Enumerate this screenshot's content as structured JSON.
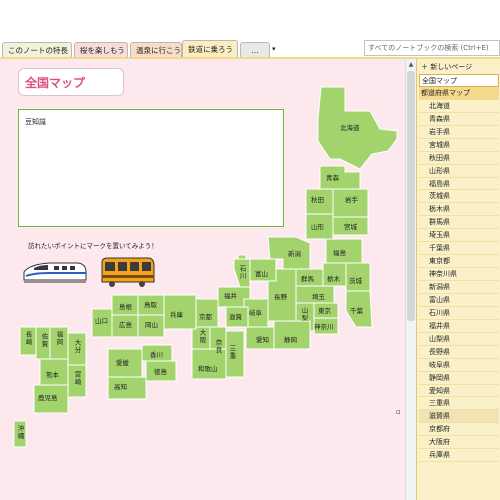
{
  "tabs": [
    {
      "label": "このノートの特長"
    },
    {
      "label": "桜を楽しもう"
    },
    {
      "label": "温泉に行こう"
    },
    {
      "label": "鉄道に乗ろう"
    }
  ],
  "tab_overflow": "...",
  "tab_add": "▾",
  "search": {
    "placeholder": "すべてのノートブックの検索 (Ctrl+E)"
  },
  "page": {
    "title": "全国マップ",
    "trivia_label": "豆知識",
    "hint": "訪れたいポイントにマークを置いてみよう！"
  },
  "map_labels": {
    "hokkaido": "北海道",
    "aomori": "青森",
    "akita": "秋田",
    "iwate": "岩手",
    "yamagata": "山形",
    "miyagi": "宮城",
    "fukushima": "福島",
    "niigata": "新潟",
    "ibaraki": "茨城",
    "tochigi": "栃木",
    "gunma": "群馬",
    "saitama": "埼玉",
    "chiba": "千葉",
    "tokyo": "東京",
    "kanagawa": "神奈川",
    "yamanashi": "山梨",
    "nagano": "長野",
    "toyama": "富山",
    "ishikawa": "石川",
    "fukui": "福井",
    "gifu": "岐阜",
    "shizuoka": "静岡",
    "aichi": "愛知",
    "mie": "三重",
    "shiga": "滋賀",
    "kyoto": "京都",
    "osaka": "大阪",
    "hyogo": "兵庫",
    "nara": "奈良",
    "wakayama": "和歌山",
    "tottori": "鳥取",
    "shimane": "島根",
    "okayama": "岡山",
    "hiroshima": "広島",
    "yamaguchi": "山口",
    "tokushima": "徳島",
    "kagawa": "香川",
    "ehime": "愛媛",
    "kochi": "高知",
    "fukuoka": "福岡",
    "saga": "佐賀",
    "nagasaki": "長崎",
    "kumamoto": "熊本",
    "oita": "大分",
    "miyazaki": "宮崎",
    "kagoshima": "鹿児島",
    "okinawa": "沖縄"
  },
  "pane": {
    "new_page": "新しいページ",
    "pages": [
      {
        "label": "全国マップ",
        "level": 0,
        "state": "selected"
      },
      {
        "label": "都道府県マップ",
        "level": 0,
        "state": "parent"
      },
      {
        "label": "北海道",
        "level": 1
      },
      {
        "label": "青森県",
        "level": 1
      },
      {
        "label": "岩手県",
        "level": 1
      },
      {
        "label": "宮城県",
        "level": 1
      },
      {
        "label": "秋田県",
        "level": 1
      },
      {
        "label": "山形県",
        "level": 1
      },
      {
        "label": "福島県",
        "level": 1
      },
      {
        "label": "茨城県",
        "level": 1
      },
      {
        "label": "栃木県",
        "level": 1
      },
      {
        "label": "群馬県",
        "level": 1
      },
      {
        "label": "埼玉県",
        "level": 1
      },
      {
        "label": "千葉県",
        "level": 1
      },
      {
        "label": "東京都",
        "level": 1
      },
      {
        "label": "神奈川県",
        "level": 1
      },
      {
        "label": "新潟県",
        "level": 1
      },
      {
        "label": "富山県",
        "level": 1
      },
      {
        "label": "石川県",
        "level": 1
      },
      {
        "label": "福井県",
        "level": 1
      },
      {
        "label": "山梨県",
        "level": 1
      },
      {
        "label": "長野県",
        "level": 1
      },
      {
        "label": "岐阜県",
        "level": 1
      },
      {
        "label": "静岡県",
        "level": 1
      },
      {
        "label": "愛知県",
        "level": 1
      },
      {
        "label": "三重県",
        "level": 1
      },
      {
        "label": "滋賀県",
        "level": 1,
        "state": "highlight"
      },
      {
        "label": "京都府",
        "level": 1
      },
      {
        "label": "大阪府",
        "level": 1
      },
      {
        "label": "兵庫県",
        "level": 1
      }
    ]
  },
  "colors": {
    "map_fill": "#a3d36c",
    "canvas_bg": "#fde8ee",
    "title_color": "#e0507d",
    "pane_bg": "#fbf1c9"
  },
  "icons": [
    "shinkansen-icon",
    "train-icon",
    "new-page-icon",
    "scroll-up-icon"
  ]
}
